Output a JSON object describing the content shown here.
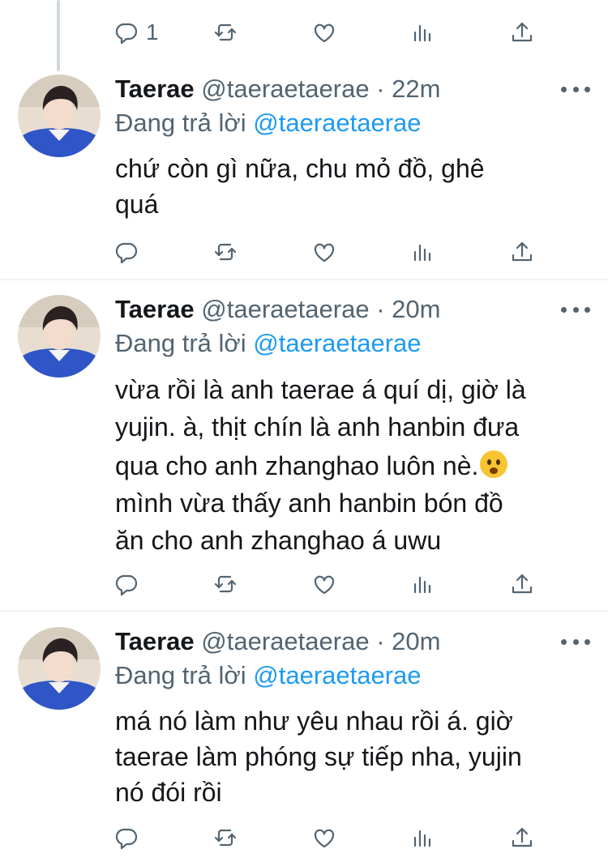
{
  "icons": {
    "reply": "reply-icon",
    "retweet": "retweet-icon",
    "like": "heart-icon",
    "views": "analytics-icon",
    "share": "share-icon",
    "more": "more-horizontal-icon"
  },
  "colors": {
    "link": "#1d9bf0",
    "muted": "#536471",
    "text": "#14171a",
    "divider": "#eff3f4"
  },
  "parent": {
    "reply_count": "1"
  },
  "tweets": [
    {
      "name": "Taerae",
      "handle": "@taeraetaerae",
      "dot": "·",
      "time": "22m",
      "replying_prefix": "Đang trả lời",
      "replying_to": "@taeraetaerae",
      "lines": [
        "chứ còn gì nữa, chu mỏ đồ, ghê",
        "quá"
      ]
    },
    {
      "name": "Taerae",
      "handle": "@taeraetaerae",
      "dot": "·",
      "time": "20m",
      "replying_prefix": "Đang trả lời",
      "replying_to": "@taeraetaerae",
      "lines": [
        "vừa rồi là anh taerae á quí dị, giờ là",
        "yujin. à, thịt chín là anh hanbin đưa",
        "qua cho anh zhanghao luôn nè.",
        "mình vừa thấy anh hanbin bón đồ",
        "ăn cho anh zhanghao á uwu"
      ],
      "emoji": "face-with-open-eyes-and-hand-over-mouth"
    },
    {
      "name": "Taerae",
      "handle": "@taeraetaerae",
      "dot": "·",
      "time": "20m",
      "replying_prefix": "Đang trả lời",
      "replying_to": "@taeraetaerae",
      "lines": [
        "má nó làm như yêu nhau rồi á. giờ",
        "taerae làm phóng sự tiếp nha, yujin",
        "nó đói rồi"
      ]
    }
  ]
}
